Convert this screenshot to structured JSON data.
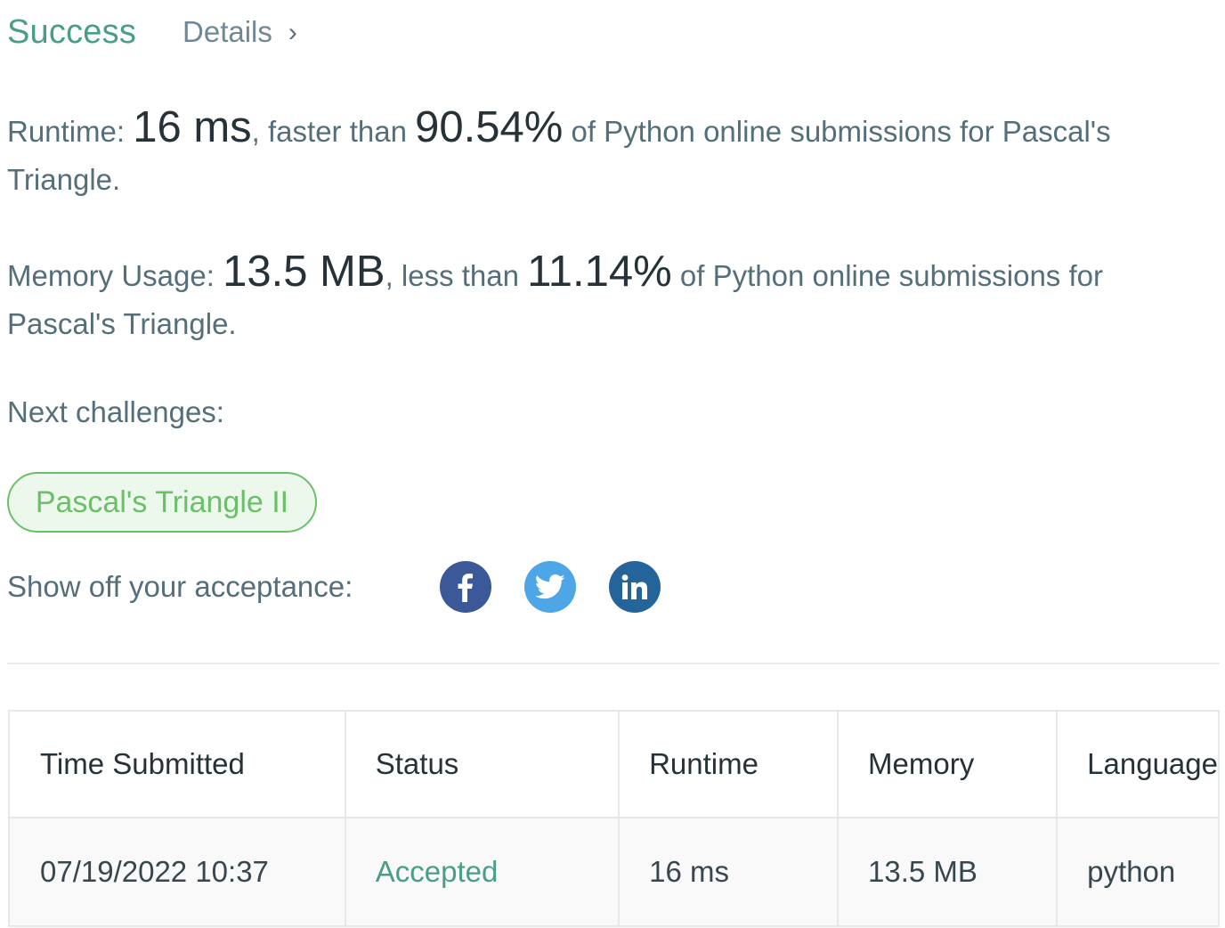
{
  "header": {
    "status": "Success",
    "details_label": "Details",
    "chevron": "›"
  },
  "runtime": {
    "label": "Runtime:",
    "value": "16 ms",
    "comparison": ", faster than ",
    "percent": "90.54%",
    "suffix": " of Python online submissions for Pascal's Triangle."
  },
  "memory": {
    "label": "Memory Usage:",
    "value": "13.5 MB",
    "comparison": ", less than ",
    "percent": "11.14%",
    "suffix": " of Python online submissions for Pascal's Triangle."
  },
  "next": {
    "label": "Next challenges:",
    "challenges": [
      "Pascal's Triangle II"
    ]
  },
  "share": {
    "label": "Show off your acceptance:",
    "icons": [
      "facebook-icon",
      "twitter-icon",
      "linkedin-icon"
    ]
  },
  "table": {
    "headers": [
      "Time Submitted",
      "Status",
      "Runtime",
      "Memory",
      "Language"
    ],
    "rows": [
      [
        "07/19/2022 10:37",
        "Accepted",
        "16 ms",
        "13.5 MB",
        "python"
      ]
    ]
  },
  "colors": {
    "success": "#4a9e88",
    "challenge_green": "#6cbf69",
    "facebook": "#3b5998",
    "twitter": "#4fa6e6",
    "linkedin": "#23649b"
  }
}
